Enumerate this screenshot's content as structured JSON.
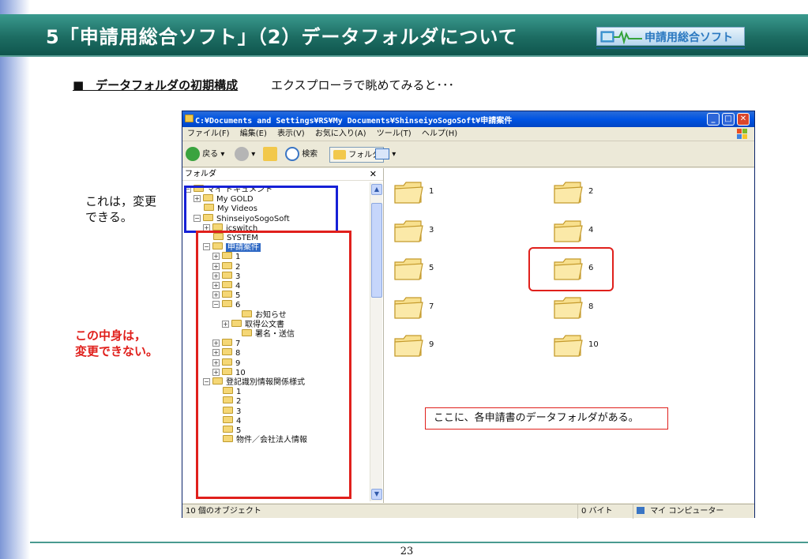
{
  "slide": {
    "title": "5「申請用総合ソフト」（2）データフォルダについて",
    "logo_text": "申請用総合ソフト",
    "section_heading": "■　データフォルダの初期構成",
    "section_sub": "エクスプローラで眺めてみると･･･",
    "note_changeable_line1": "これは，変更",
    "note_changeable_line2": "できる。",
    "note_not_changeable_line1": "この中身は，",
    "note_not_changeable_line2": "変更できない。",
    "callout": "ここに、各申請書のデータフォルダがある。",
    "page_number": "23",
    "colors": {
      "header": "#1d6d63",
      "annotation_red": "#e0201c",
      "annotation_blue": "#1621d6",
      "selection": "#316ac5"
    }
  },
  "window": {
    "title": "C:¥Documents and Settings¥RS¥My Documents¥ShinseiyoSogoSoft¥申請案件",
    "menu": [
      "ファイル(F)",
      "編集(E)",
      "表示(V)",
      "お気に入り(A)",
      "ツール(T)",
      "ヘルプ(H)"
    ],
    "toolbar": {
      "back": "戻る",
      "search": "検索",
      "folders": "フォルダ"
    },
    "tree_header": "フォルダ",
    "tree": [
      {
        "label": "マイ ドキュメント",
        "expander": "⊟",
        "icon": "open-folder-icon"
      },
      {
        "label": "My GOLD",
        "expander": "⊞",
        "icon": "folder-icon"
      },
      {
        "label": "My Videos",
        "expander": "",
        "icon": "folder-icon"
      },
      {
        "label": "ShinseiyoSogoSoft",
        "expander": "⊟",
        "icon": "open-folder-icon"
      },
      {
        "label": "icswitch",
        "expander": "⊞",
        "icon": "folder-icon"
      },
      {
        "label": "SYSTEM",
        "expander": "",
        "icon": "folder-icon"
      },
      {
        "label": "申請案件",
        "expander": "⊟",
        "icon": "open-folder-icon",
        "selected": true
      },
      {
        "label": "1",
        "expander": "⊞",
        "icon": "folder-icon"
      },
      {
        "label": "2",
        "expander": "⊞",
        "icon": "folder-icon"
      },
      {
        "label": "3",
        "expander": "⊞",
        "icon": "folder-icon"
      },
      {
        "label": "4",
        "expander": "⊞",
        "icon": "folder-icon"
      },
      {
        "label": "5",
        "expander": "⊞",
        "icon": "folder-icon"
      },
      {
        "label": "6",
        "expander": "⊟",
        "icon": "open-folder-icon"
      },
      {
        "label": "お知らせ",
        "expander": "",
        "icon": "folder-icon"
      },
      {
        "label": "取得公文書",
        "expander": "⊞",
        "icon": "folder-icon"
      },
      {
        "label": "署名・送信",
        "expander": "",
        "icon": "folder-icon"
      },
      {
        "label": "7",
        "expander": "⊞",
        "icon": "folder-icon"
      },
      {
        "label": "8",
        "expander": "⊞",
        "icon": "folder-icon"
      },
      {
        "label": "9",
        "expander": "⊞",
        "icon": "folder-icon"
      },
      {
        "label": "10",
        "expander": "⊞",
        "icon": "folder-icon"
      },
      {
        "label": "登記識別情報関係様式",
        "expander": "⊟",
        "icon": "open-folder-icon"
      },
      {
        "label": "1",
        "expander": "",
        "icon": "folder-icon"
      },
      {
        "label": "2",
        "expander": "",
        "icon": "folder-icon"
      },
      {
        "label": "3",
        "expander": "",
        "icon": "folder-icon"
      },
      {
        "label": "4",
        "expander": "",
        "icon": "folder-icon"
      },
      {
        "label": "5",
        "expander": "",
        "icon": "folder-icon"
      },
      {
        "label": "物件／会社法人情報",
        "expander": "",
        "icon": "folder-icon"
      }
    ],
    "content_folders": [
      "1",
      "2",
      "3",
      "4",
      "5",
      "6",
      "7",
      "8",
      "9",
      "10"
    ],
    "status": {
      "objects": "10 個のオブジェクト",
      "size": "0 バイト",
      "location": "マイ コンピューター"
    }
  }
}
